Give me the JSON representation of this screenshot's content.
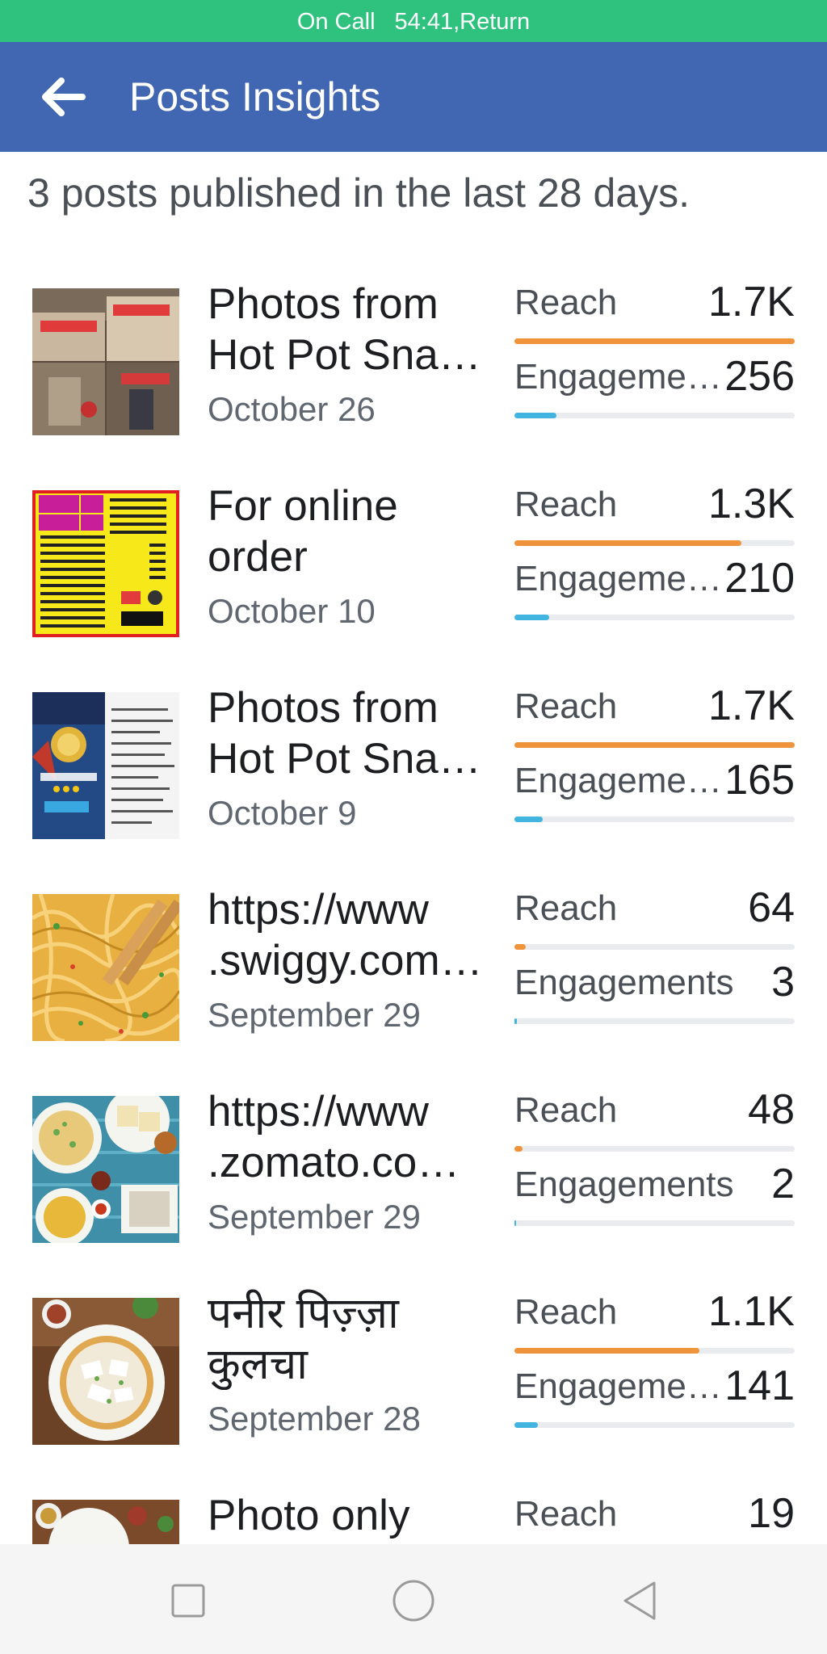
{
  "status_bar": {
    "call_label": "On Call",
    "call_info": "54:41,Return",
    "color": "#2ec27e"
  },
  "app_bar": {
    "title": "Posts Insights",
    "back_icon": "arrow-left-icon",
    "color": "#4267b2"
  },
  "summary": "3 posts published in the last 28 days.",
  "colors": {
    "reach_bar": "#f0943c",
    "engagement_bar": "#42b4e0",
    "track": "#e9ebee"
  },
  "posts": [
    {
      "title_lines": [
        "Photos from",
        "Hot Pot Sna…"
      ],
      "date": "October 26",
      "reach_label": "Reach",
      "reach_value": "1.7K",
      "reach_fraction": 1.0,
      "engagement_label": "Engageme…",
      "engagement_value": "256",
      "engagement_fraction": 0.15
    },
    {
      "title_lines": [
        "For online",
        "order"
      ],
      "date": "October 10",
      "reach_label": "Reach",
      "reach_value": "1.3K",
      "reach_fraction": 0.81,
      "engagement_label": "Engageme…",
      "engagement_value": "210",
      "engagement_fraction": 0.125
    },
    {
      "title_lines": [
        "Photos from",
        "Hot Pot Sna…"
      ],
      "date": "October 9",
      "reach_label": "Reach",
      "reach_value": "1.7K",
      "reach_fraction": 1.0,
      "engagement_label": "Engageme…",
      "engagement_value": "165",
      "engagement_fraction": 0.1
    },
    {
      "title_lines": [
        "https://www",
        ".swiggy.com…"
      ],
      "date": "September 29",
      "reach_label": "Reach",
      "reach_value": "64",
      "reach_fraction": 0.04,
      "engagement_label": "Engagements",
      "engagement_value": "3",
      "engagement_fraction": 0.008
    },
    {
      "title_lines": [
        "https://www",
        ".zomato.co…"
      ],
      "date": "September 29",
      "reach_label": "Reach",
      "reach_value": "48",
      "reach_fraction": 0.03,
      "engagement_label": "Engagements",
      "engagement_value": "2",
      "engagement_fraction": 0.005
    },
    {
      "title_lines": [
        "पनीर पिज़्ज़ा",
        "कुलचा"
      ],
      "date": "September 28",
      "reach_label": "Reach",
      "reach_value": "1.1K",
      "reach_fraction": 0.66,
      "engagement_label": "Engageme…",
      "engagement_value": "141",
      "engagement_fraction": 0.085
    },
    {
      "title_lines": [
        "Photo only",
        ""
      ],
      "date": "",
      "reach_label": "Reach",
      "reach_value": "19",
      "reach_fraction": 0.012,
      "engagement_label": "",
      "engagement_value": "",
      "engagement_fraction": 0.0
    }
  ],
  "nav_bar": {
    "recents_icon": "square-recents-icon",
    "home_icon": "circle-home-icon",
    "back_icon": "triangle-back-icon"
  }
}
